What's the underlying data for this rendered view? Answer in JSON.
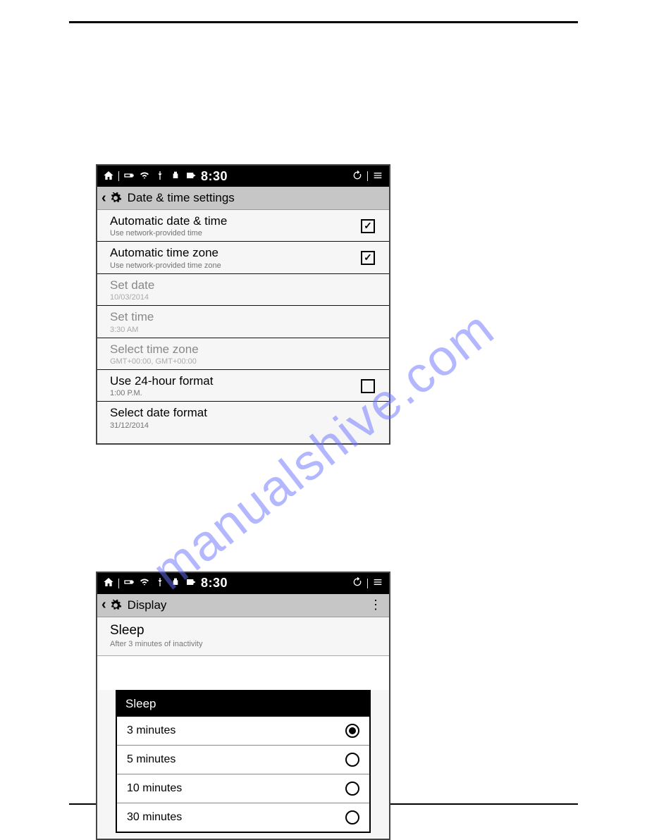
{
  "watermark": "manualshive.com",
  "phone1": {
    "status_time": "8:30",
    "app_title": "Date & time settings",
    "rows": [
      {
        "title": "Automatic date & time",
        "sub": "Use network-provided time",
        "checked": true,
        "disabled": false
      },
      {
        "title": "Automatic time zone",
        "sub": "Use network-provided time zone",
        "checked": true,
        "disabled": false
      },
      {
        "title": "Set date",
        "sub": "10/03/2014",
        "checked": null,
        "disabled": true
      },
      {
        "title": "Set time",
        "sub": "3:30 AM",
        "checked": null,
        "disabled": true
      },
      {
        "title": "Select time zone",
        "sub": "GMT+00:00, GMT+00:00",
        "checked": null,
        "disabled": true
      },
      {
        "title": "Use 24-hour format",
        "sub": "1:00 P.M.",
        "checked": false,
        "disabled": false
      },
      {
        "title": "Select date format",
        "sub": "31/12/2014",
        "checked": null,
        "disabled": false
      }
    ]
  },
  "phone2": {
    "status_time": "8:30",
    "app_title": "Display",
    "sleep_title": "Sleep",
    "sleep_sub": "After 3 minutes of inactivity",
    "dialog_title": "Sleep",
    "options": [
      {
        "label": "3 minutes",
        "selected": true
      },
      {
        "label": "5 minutes",
        "selected": false
      },
      {
        "label": "10 minutes",
        "selected": false
      },
      {
        "label": "30 minutes",
        "selected": false
      }
    ]
  }
}
